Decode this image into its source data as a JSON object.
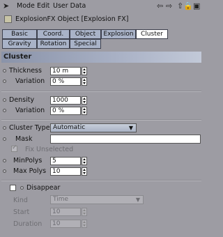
{
  "menu": {
    "mode": "Mode",
    "edit": "Edit",
    "user_data": "User Data"
  },
  "object_title": "ExplosionFX Object [Explosion FX]",
  "tabs_row1": [
    "Basic",
    "Coord.",
    "Object",
    "Explosion",
    "Cluster"
  ],
  "tabs_row2": [
    "Gravity",
    "Rotation",
    "Special"
  ],
  "active_tab": "Cluster",
  "section_title": "Cluster",
  "thickness": {
    "label": "Thickness",
    "value": "10 m"
  },
  "thickness_variation": {
    "label": "Variation",
    "value": "0 %"
  },
  "density": {
    "label": "Density",
    "value": "1000"
  },
  "density_variation": {
    "label": "Variation",
    "value": "0 %"
  },
  "cluster_type": {
    "label": "Cluster Type",
    "value": "Automatic"
  },
  "mask": {
    "label": "Mask",
    "value": ""
  },
  "fix_unselected": {
    "label": "Fix Unselected",
    "checked": true
  },
  "min_polys": {
    "label": "MinPolys",
    "value": "5"
  },
  "max_polys": {
    "label": "Max Polys",
    "value": "10"
  },
  "disappear": {
    "label": "Disappear",
    "checked": false
  },
  "kind": {
    "label": "Kind",
    "value": "Time"
  },
  "start": {
    "label": "Start",
    "value": "10"
  },
  "duration": {
    "label": "Duration",
    "value": "10"
  },
  "colors": {
    "tab_bg": "#a9b3c8",
    "active_tab_bg": "#ffffff",
    "panel_bg": "#9d9ca3"
  }
}
